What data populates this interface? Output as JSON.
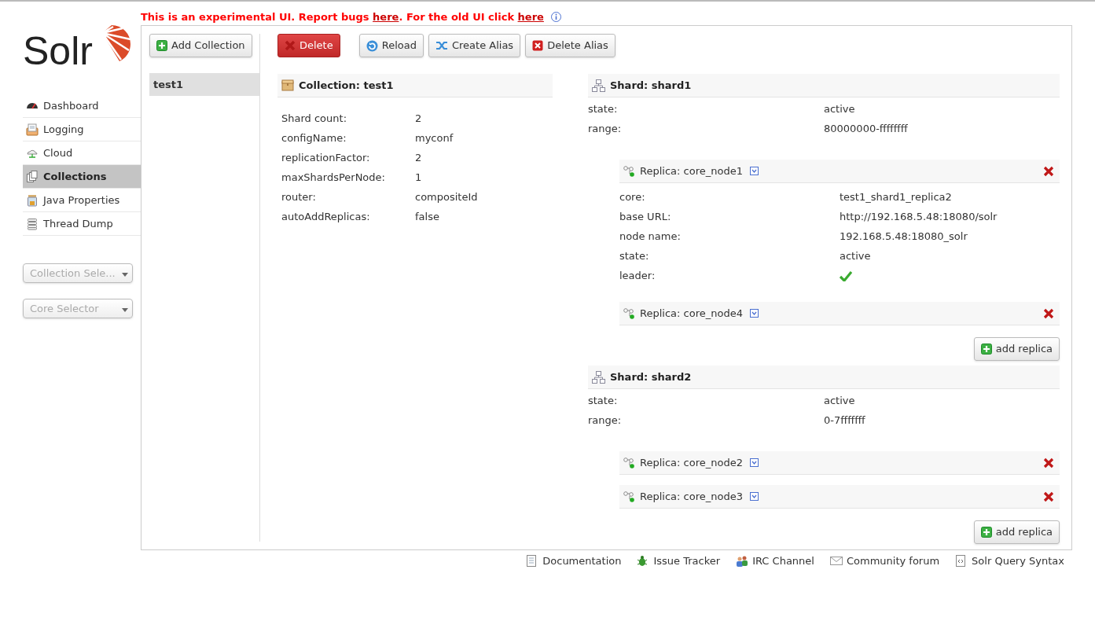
{
  "banner": [
    {
      "kind": "text",
      "text": "This is an experimental UI. Report bugs "
    },
    {
      "kind": "link",
      "text": "here"
    },
    {
      "kind": "text",
      "text": ". For the old UI click "
    },
    {
      "kind": "link",
      "text": "here"
    }
  ],
  "logo": {
    "text": "Solr"
  },
  "nav": [
    {
      "label": "Dashboard",
      "selected": false
    },
    {
      "label": "Logging",
      "selected": false
    },
    {
      "label": "Cloud",
      "selected": false
    },
    {
      "label": "Collections",
      "selected": true
    },
    {
      "label": "Java Properties",
      "selected": false
    },
    {
      "label": "Thread Dump",
      "selected": false
    }
  ],
  "selectors": [
    {
      "placeholder": "Collection Sele..."
    },
    {
      "placeholder": "Core Selector"
    }
  ],
  "add_collection_button": "Add Collection",
  "collections": [
    {
      "name": "test1",
      "selected": true
    }
  ],
  "toolbar": [
    {
      "label": "Delete",
      "kind": "danger"
    },
    {
      "label": "Reload",
      "kind": "reload"
    },
    {
      "label": "Create Alias",
      "kind": "alias"
    },
    {
      "label": "Delete Alias",
      "kind": "delete"
    }
  ],
  "collection": {
    "title": "Collection: test1",
    "fields": [
      {
        "label": "Shard count:",
        "value": "2"
      },
      {
        "label": "configName:",
        "value": "myconf"
      },
      {
        "label": "replicationFactor:",
        "value": "2"
      },
      {
        "label": "maxShardsPerNode:",
        "value": "1"
      },
      {
        "label": "router:",
        "value": "compositeId"
      },
      {
        "label": "autoAddReplicas:",
        "value": "false"
      }
    ]
  },
  "shards": [
    {
      "title": "Shard: shard1",
      "fields": [
        {
          "label": "state:",
          "value": "active"
        },
        {
          "label": "range:",
          "value": "80000000-ffffffff"
        }
      ],
      "replicas": [
        {
          "title": "Replica: core_node1",
          "fields": [
            {
              "label": "core:",
              "kind": "text",
              "value": "test1_shard1_replica2"
            },
            {
              "label": "base URL:",
              "kind": "text",
              "value": "http://192.168.5.48:18080/solr"
            },
            {
              "label": "node name:",
              "kind": "text",
              "value": "192.168.5.48:18080_solr"
            },
            {
              "label": "state:",
              "kind": "text",
              "value": "active"
            },
            {
              "label": "leader:",
              "kind": "check",
              "checked": true
            }
          ]
        },
        {
          "title": "Replica: core_node4"
        }
      ],
      "add_replica_button": "add replica"
    },
    {
      "title": "Shard: shard2",
      "fields": [
        {
          "label": "state:",
          "value": "active"
        },
        {
          "label": "range:",
          "value": "0-7fffffff"
        }
      ],
      "replicas": [
        {
          "title": "Replica: core_node2"
        },
        {
          "title": "Replica: core_node3"
        }
      ],
      "add_replica_button": "add replica"
    }
  ],
  "footer": [
    {
      "label": "Documentation"
    },
    {
      "label": "Issue Tracker"
    },
    {
      "label": "IRC Channel"
    },
    {
      "label": "Community forum"
    },
    {
      "label": "Solr Query Syntax"
    }
  ]
}
